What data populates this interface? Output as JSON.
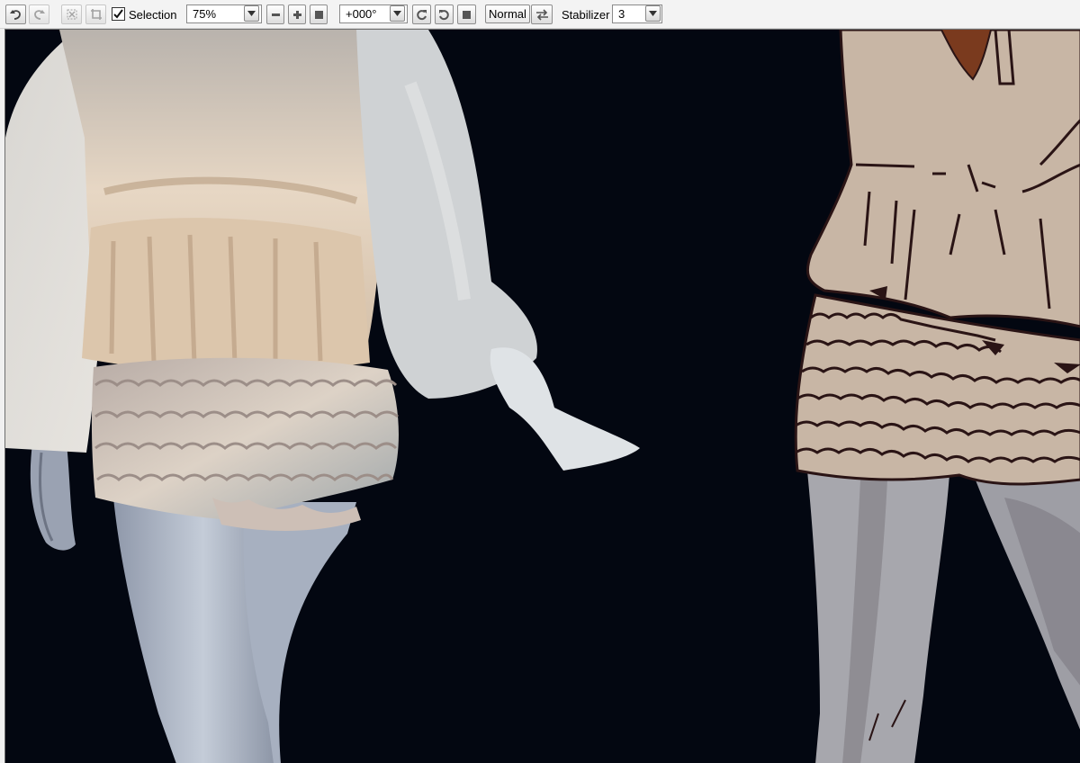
{
  "toolbar": {
    "undo_icon": "undo-icon",
    "redo_icon": "redo-icon",
    "deselect_icon": "deselect-icon",
    "crop_icon": "crop-icon",
    "selection": {
      "label": "Selection",
      "checked": true
    },
    "zoom": {
      "value": "75%"
    },
    "zoom_out_icon": "minus-icon",
    "zoom_in_icon": "plus-icon",
    "zoom_reset_icon": "square-icon",
    "rotation": {
      "value": "+000°"
    },
    "rotate_ccw_icon": "rotate-left-icon",
    "rotate_cw_icon": "rotate-right-icon",
    "rotate_reset_icon": "square-icon",
    "view_mode_label": "Normal",
    "flip_icon": "flip-horizontal-icon",
    "stabilizer": {
      "label": "Stabilizer",
      "value": "3"
    }
  },
  "canvas": {
    "background": "#030711",
    "content": "painting-canvas"
  },
  "colors": {
    "toolbar_bg": "#f3f3f3",
    "canvas_bg": "#030711",
    "sketch_fill": "#c7b3a3",
    "line_art": "#2a1415"
  }
}
